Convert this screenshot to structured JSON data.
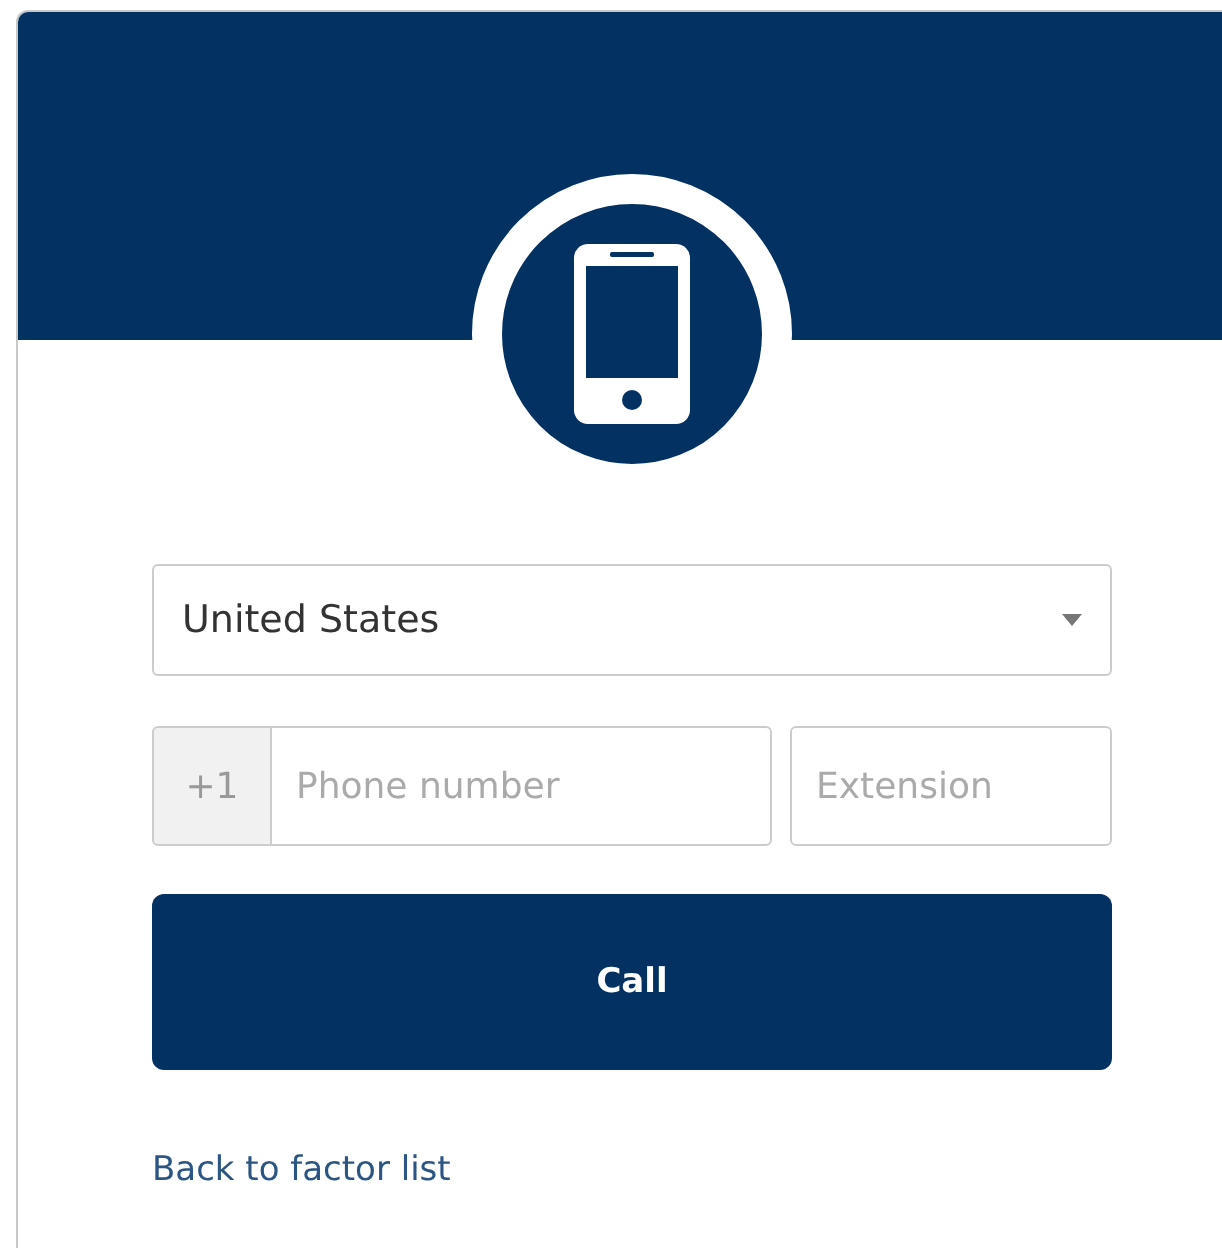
{
  "country_select": {
    "value": "United States"
  },
  "phone": {
    "prefix": "+1",
    "placeholder": "Phone number"
  },
  "extension": {
    "placeholder": "Extension"
  },
  "call_button": {
    "label": "Call"
  },
  "back_link": {
    "label": "Back to factor list"
  }
}
